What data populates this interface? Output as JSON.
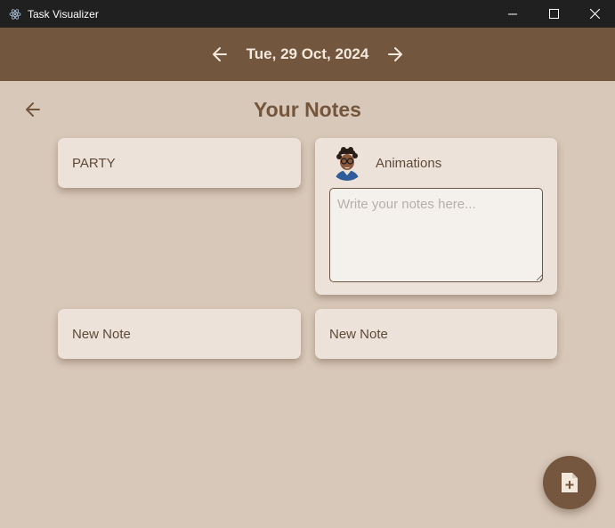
{
  "window": {
    "title": "Task Visualizer",
    "controls": [
      "minimize",
      "maximize",
      "close"
    ]
  },
  "header": {
    "date": "Tue, 29 Oct, 2024",
    "prev_icon": "arrow-left-icon",
    "next_icon": "arrow-right-icon"
  },
  "page": {
    "title": "Your Notes",
    "back_icon": "arrow-left-icon"
  },
  "notes": [
    {
      "title": "PARTY",
      "expanded": false
    },
    {
      "title": "Animations",
      "expanded": true,
      "has_avatar": true,
      "notes_value": "",
      "notes_placeholder": "Write your notes here..."
    },
    {
      "title": "New Note",
      "expanded": false
    },
    {
      "title": "New Note",
      "expanded": false
    }
  ],
  "fab": {
    "icon": "add-note-icon"
  },
  "colors": {
    "background": "#d8c8b9",
    "header": "#72563d",
    "card": "#ece2d9",
    "accent": "#74563c",
    "titlebar": "#202020"
  }
}
